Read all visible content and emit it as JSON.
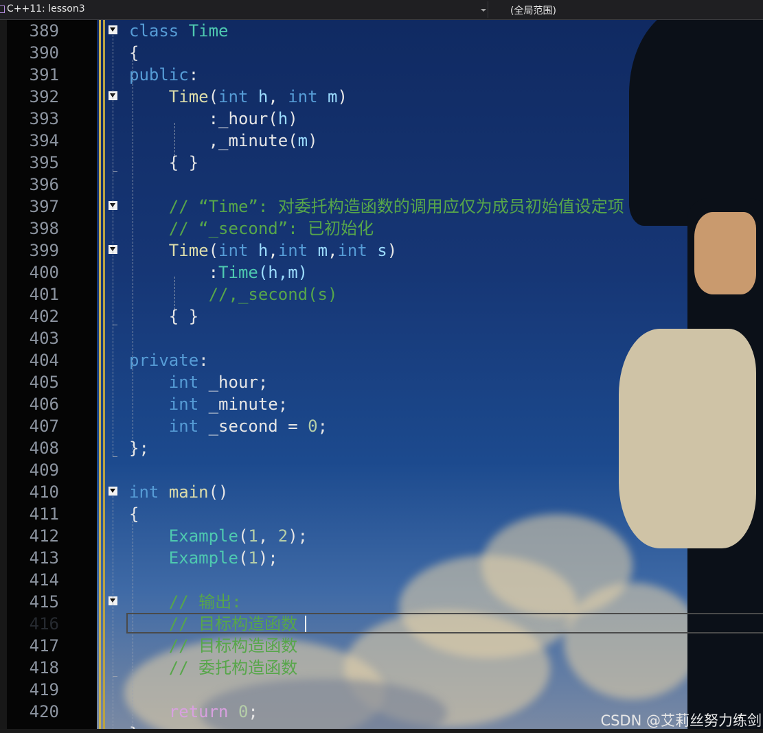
{
  "navbar": {
    "project_dropdown": "C++11: lesson3",
    "scope_dropdown": "(全局范围)"
  },
  "line_numbers": [
    "389",
    "390",
    "391",
    "392",
    "393",
    "394",
    "395",
    "396",
    "397",
    "398",
    "399",
    "400",
    "401",
    "402",
    "403",
    "404",
    "405",
    "406",
    "407",
    "408",
    "409",
    "410",
    "411",
    "412",
    "413",
    "414",
    "415",
    "416",
    "417",
    "418",
    "419",
    "420"
  ],
  "current_line": "416",
  "code": {
    "l389": {
      "kw": "class",
      "ty": "Time"
    },
    "l390": {
      "brace": "{"
    },
    "l391": {
      "kw": "public",
      "colon": ":"
    },
    "l392": {
      "fn": "Time",
      "open": "(",
      "kw1": "int",
      "p1": "h",
      "comma": ",",
      "kw2": "int",
      "p2": "m",
      "close": ")"
    },
    "l393": {
      "text": ":_hour(",
      "p": "h",
      "close": ")"
    },
    "l394": {
      "text": ",_minute(",
      "p": "m",
      "close": ")"
    },
    "l395": {
      "text": "{ }"
    },
    "l397": {
      "comment": "// “Time”: 对委托构造函数的调用应仅为成员初始值设定项"
    },
    "l398": {
      "comment": "// “_second”: 已初始化"
    },
    "l399": {
      "fn": "Time",
      "open": "(",
      "kw1": "int",
      "p1": "h",
      "kw2": "int",
      "p2": "m",
      "kw3": "int",
      "p3": "s",
      "close": ")",
      "comma": ","
    },
    "l400": {
      "colon": ":",
      "ty": "Time",
      "args": "(h,m)"
    },
    "l401": {
      "comment": "//,_second(s)"
    },
    "l402": {
      "text": "{ }"
    },
    "l404": {
      "kw": "private",
      "colon": ":"
    },
    "l405": {
      "kw": "int",
      "text": "_hour;"
    },
    "l406": {
      "kw": "int",
      "text": "_minute;"
    },
    "l407": {
      "kw": "int",
      "text": "_second = ",
      "num": "0",
      "semi": ";"
    },
    "l408": {
      "text": "};"
    },
    "l410": {
      "kw": "int",
      "fn": "main",
      "parens": "()"
    },
    "l411": {
      "brace": "{"
    },
    "l412": {
      "ty": "Example",
      "open": "(",
      "n1": "1",
      "comma": ", ",
      "n2": "2",
      "close": ");"
    },
    "l413": {
      "ty": "Example",
      "open": "(",
      "n1": "1",
      "close": ");"
    },
    "l415": {
      "comment": "// 输出:"
    },
    "l416": {
      "comment": "// 目标构造函数"
    },
    "l417": {
      "comment": "// 目标构造函数"
    },
    "l418": {
      "comment": "// 委托构造函数"
    },
    "l420": {
      "kw": "return",
      "num": "0",
      "semi": ";"
    },
    "l421": {
      "text": "}"
    }
  },
  "watermark": "CSDN @艾莉丝努力练剑",
  "colors": {
    "keyword": "#569cd6",
    "type": "#4ec9b0",
    "function": "#dcdcaa",
    "parameter": "#9cdcfe",
    "number": "#b5cea8",
    "control": "#d8a0df",
    "comment": "#57a64a"
  }
}
